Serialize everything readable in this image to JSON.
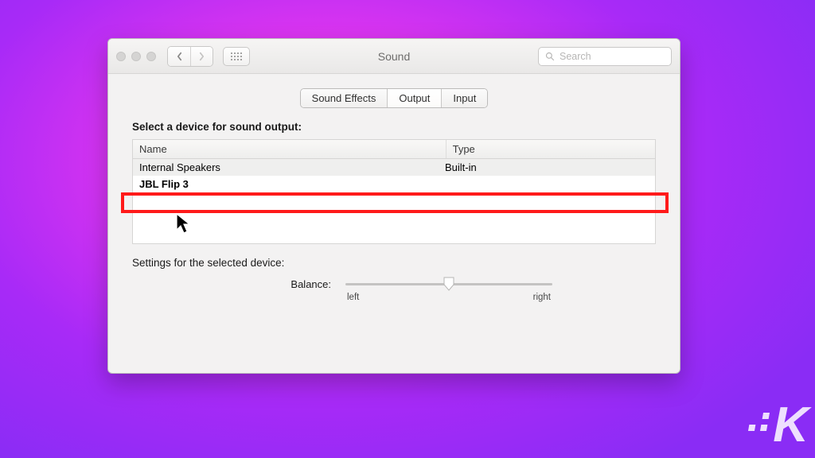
{
  "window": {
    "title": "Sound",
    "search_placeholder": "Search"
  },
  "tabs": {
    "sound_effects": "Sound Effects",
    "output": "Output",
    "input": "Input",
    "active": "output"
  },
  "output_section": {
    "heading": "Select a device for sound output:",
    "columns": {
      "name": "Name",
      "type": "Type"
    },
    "devices": [
      {
        "name": "Internal Speakers",
        "type": "Built-in"
      },
      {
        "name": "JBL Flip 3",
        "type": ""
      }
    ]
  },
  "settings_section": {
    "heading": "Settings for the selected device:",
    "balance_label": "Balance:",
    "left_label": "left",
    "right_label": "right",
    "balance_value": 0.5
  },
  "annotations": {
    "highlighted_device_index": 1
  },
  "watermark": "K"
}
